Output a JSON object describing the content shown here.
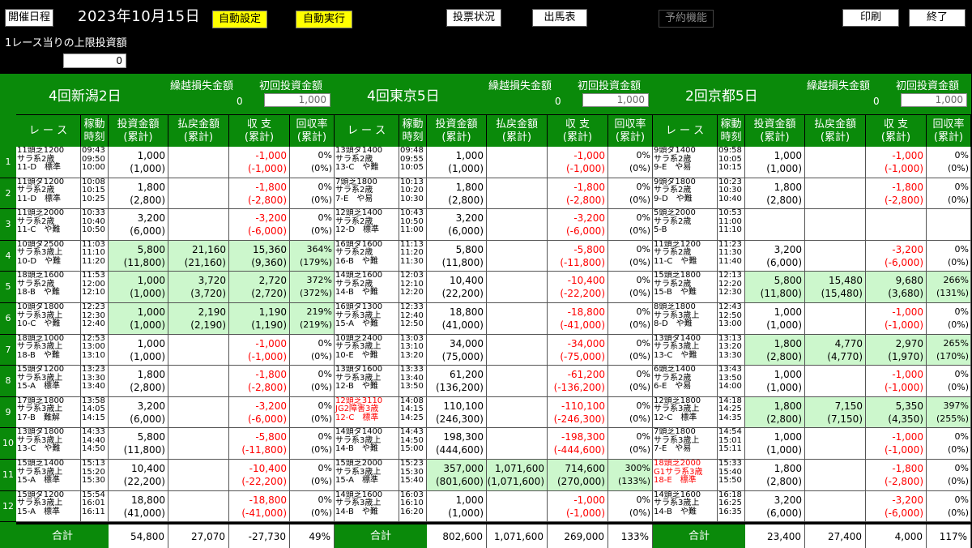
{
  "toolbar": {
    "schedule_label": "開催日程",
    "date": "2023年10月15日",
    "auto_setting_label": "自動設定",
    "auto_exec_label": "自動実行",
    "vote_status_label": "投票状況",
    "entries_label": "出馬表",
    "reservation_label": "予約機能",
    "print_label": "印刷",
    "exit_label": "終了"
  },
  "limit": {
    "label": "1レース当りの上限投資額",
    "value": "0"
  },
  "colheaders": {
    "race": "レ ー ス",
    "time": "稼動\n時刻",
    "invest": "投資金額\n(累計)",
    "refund": "払戻金額\n(累計)",
    "balance": "収 支\n(累計)",
    "rate": "回収率\n(累計)"
  },
  "venue_hdr": {
    "carry_label": "繰越損失金額",
    "initial_label": "初回投資金額"
  },
  "total_label": "合計",
  "venues": [
    {
      "name": "4回新潟2日",
      "carry": "0",
      "initial": "1,000",
      "rows": [
        {
          "race": [
            "11頭芝1200",
            "サラ系2歳",
            "11-D　標準"
          ],
          "times": [
            "09:43",
            "09:50",
            "10:00"
          ],
          "inv": "1,000",
          "invc": "(1,000)",
          "ref": "",
          "refc": "",
          "bal": "-1,000",
          "balc": "(-1,000)",
          "rate": "0%",
          "ratec": "(0%)",
          "green": false
        },
        {
          "race": [
            "11頭ダ1200",
            "サラ系2歳",
            "11-D　標準"
          ],
          "times": [
            "10:08",
            "10:15",
            "10:25"
          ],
          "inv": "1,800",
          "invc": "(2,800)",
          "ref": "",
          "refc": "",
          "bal": "-1,800",
          "balc": "(-2,800)",
          "rate": "0%",
          "ratec": "(0%)",
          "green": false
        },
        {
          "race": [
            "11頭芝2000",
            "サラ系2歳",
            "11-C　や難"
          ],
          "times": [
            "10:33",
            "10:40",
            "10:50"
          ],
          "inv": "3,200",
          "invc": "(6,000)",
          "ref": "",
          "refc": "",
          "bal": "-3,200",
          "balc": "(-6,000)",
          "rate": "0%",
          "ratec": "(0%)",
          "green": false
        },
        {
          "race": [
            "10頭ダ2500",
            "サラ系3歳上",
            "10-D　や難"
          ],
          "times": [
            "11:03",
            "11:10",
            "11:20"
          ],
          "inv": "5,800",
          "invc": "(11,800)",
          "ref": "21,160",
          "refc": "(21,160)",
          "bal": "15,360",
          "balc": "(9,360)",
          "rate": "364%",
          "ratec": "(179%)",
          "green": true
        },
        {
          "race": [
            "18頭芝1600",
            "サラ系2歳",
            "18-B　や難"
          ],
          "times": [
            "11:53",
            "12:00",
            "12:10"
          ],
          "inv": "1,000",
          "invc": "(1,000)",
          "ref": "3,720",
          "refc": "(3,720)",
          "bal": "2,720",
          "balc": "(2,720)",
          "rate": "372%",
          "ratec": "(372%)",
          "green": true
        },
        {
          "race": [
            "10頭ダ1800",
            "サラ系3歳上",
            "10-C　や難"
          ],
          "times": [
            "12:23",
            "12:30",
            "12:40"
          ],
          "inv": "1,000",
          "invc": "(1,000)",
          "ref": "2,190",
          "refc": "(2,190)",
          "bal": "1,190",
          "balc": "(1,190)",
          "rate": "219%",
          "ratec": "(219%)",
          "green": true
        },
        {
          "race": [
            "18頭芝1000",
            "サラ系3歳上",
            "18-B　や難"
          ],
          "times": [
            "12:53",
            "13:00",
            "13:10"
          ],
          "inv": "1,000",
          "invc": "(1,000)",
          "ref": "",
          "refc": "",
          "bal": "-1,000",
          "balc": "(-1,000)",
          "rate": "0%",
          "ratec": "(0%)",
          "green": false
        },
        {
          "race": [
            "15頭ダ1200",
            "サラ系3歳上",
            "15-A　標準"
          ],
          "times": [
            "13:23",
            "13:30",
            "13:40"
          ],
          "inv": "1,800",
          "invc": "(2,800)",
          "ref": "",
          "refc": "",
          "bal": "-1,800",
          "balc": "(-2,800)",
          "rate": "0%",
          "ratec": "(0%)",
          "green": false
        },
        {
          "race": [
            "17頭芝1800",
            "サラ系3歳上",
            "17-B　難解"
          ],
          "times": [
            "13:58",
            "14:05",
            "14:15"
          ],
          "inv": "3,200",
          "invc": "(6,000)",
          "ref": "",
          "refc": "",
          "bal": "-3,200",
          "balc": "(-6,000)",
          "rate": "0%",
          "ratec": "(0%)",
          "green": false
        },
        {
          "race": [
            "13頭ダ1800",
            "サラ系3歳上",
            "13-C　や難"
          ],
          "times": [
            "14:33",
            "14:40",
            "14:50"
          ],
          "inv": "5,800",
          "invc": "(11,800)",
          "ref": "",
          "refc": "",
          "bal": "-5,800",
          "balc": "(-11,800)",
          "rate": "0%",
          "ratec": "(0%)",
          "green": false
        },
        {
          "race": [
            "15頭芝1400",
            "サラ系3歳上",
            "15-A　標準"
          ],
          "times": [
            "15:13",
            "15:20",
            "15:30"
          ],
          "inv": "10,400",
          "invc": "(22,200)",
          "ref": "",
          "refc": "",
          "bal": "-10,400",
          "balc": "(-22,200)",
          "rate": "0%",
          "ratec": "(0%)",
          "green": false
        },
        {
          "race": [
            "15頭ダ1200",
            "サラ系3歳上",
            "15-A　標準"
          ],
          "times": [
            "15:54",
            "16:01",
            "16:11"
          ],
          "inv": "18,800",
          "invc": "(41,000)",
          "ref": "",
          "refc": "",
          "bal": "-18,800",
          "balc": "(-41,000)",
          "rate": "0%",
          "ratec": "(0%)",
          "green": false
        }
      ],
      "totals": {
        "inv": "54,800",
        "ref": "27,070",
        "bal": "-27,730",
        "rate": "49%"
      }
    },
    {
      "name": "4回東京5日",
      "carry": "0",
      "initial": "1,000",
      "rows": [
        {
          "race": [
            "13頭ダ1400",
            "サラ系2歳",
            "13-C　や難"
          ],
          "times": [
            "09:48",
            "09:55",
            "10:05"
          ],
          "inv": "1,000",
          "invc": "(1,000)",
          "ref": "",
          "refc": "",
          "bal": "-1,000",
          "balc": "(-1,000)",
          "rate": "0%",
          "ratec": "(0%)",
          "green": false
        },
        {
          "race": [
            "7頭芝1800",
            "サラ系2歳",
            "7-E　や易"
          ],
          "times": [
            "10:13",
            "10:20",
            "10:30"
          ],
          "inv": "1,800",
          "invc": "(2,800)",
          "ref": "",
          "refc": "",
          "bal": "-1,800",
          "balc": "(-2,800)",
          "rate": "0%",
          "ratec": "(0%)",
          "green": false
        },
        {
          "race": [
            "12頭芝1400",
            "サラ系2歳",
            "12-D　標準"
          ],
          "times": [
            "10:43",
            "10:50",
            "11:00"
          ],
          "inv": "3,200",
          "invc": "(6,000)",
          "ref": "",
          "refc": "",
          "bal": "-3,200",
          "balc": "(-6,000)",
          "rate": "0%",
          "ratec": "(0%)",
          "green": false
        },
        {
          "race": [
            "16頭ダ1600",
            "サラ系2歳",
            "16-B　や難"
          ],
          "times": [
            "11:13",
            "11:20",
            "11:30"
          ],
          "inv": "5,800",
          "invc": "(11,800)",
          "ref": "",
          "refc": "",
          "bal": "-5,800",
          "balc": "(-11,800)",
          "rate": "0%",
          "ratec": "(0%)",
          "green": false
        },
        {
          "race": [
            "14頭芝1600",
            "サラ系2歳",
            "14-B　や難"
          ],
          "times": [
            "12:03",
            "12:10",
            "12:20"
          ],
          "inv": "10,400",
          "invc": "(22,200)",
          "ref": "",
          "refc": "",
          "bal": "-10,400",
          "balc": "(-22,200)",
          "rate": "0%",
          "ratec": "(0%)",
          "green": false
        },
        {
          "race": [
            "16頭ダ1300",
            "サラ系3歳上",
            "15-A　や難"
          ],
          "times": [
            "12:33",
            "12:40",
            "12:50"
          ],
          "inv": "18,800",
          "invc": "(41,000)",
          "ref": "",
          "refc": "",
          "bal": "-18,800",
          "balc": "(-41,000)",
          "rate": "0%",
          "ratec": "(0%)",
          "green": false
        },
        {
          "race": [
            "10頭芝2400",
            "サラ系3歳上",
            "10-E　や難"
          ],
          "times": [
            "13:03",
            "13:10",
            "13:20"
          ],
          "inv": "34,000",
          "invc": "(75,000)",
          "ref": "",
          "refc": "",
          "bal": "-34,000",
          "balc": "(-75,000)",
          "rate": "0%",
          "ratec": "(0%)",
          "green": false
        },
        {
          "race": [
            "13頭ダ1600",
            "サラ系3歳上",
            "12-B　や難"
          ],
          "times": [
            "13:33",
            "13:40",
            "13:50"
          ],
          "inv": "61,200",
          "invc": "(136,200)",
          "ref": "",
          "refc": "",
          "bal": "-61,200",
          "balc": "(-136,200)",
          "rate": "0%",
          "ratec": "(0%)",
          "green": false
        },
        {
          "race": [
            "12頭芝3110",
            "JG2障害3歳",
            "12-C　標準"
          ],
          "times": [
            "14:08",
            "14:15",
            "14:25"
          ],
          "inv": "110,100",
          "invc": "(246,300)",
          "ref": "",
          "refc": "",
          "bal": "-110,100",
          "balc": "(-246,300)",
          "rate": "0%",
          "ratec": "(0%)",
          "green": false,
          "red": true
        },
        {
          "race": [
            "14頭ダ1400",
            "サラ系3歳上",
            "14-B　や難"
          ],
          "times": [
            "14:43",
            "14:50",
            "15:00"
          ],
          "inv": "198,300",
          "invc": "(444,600)",
          "ref": "",
          "refc": "",
          "bal": "-198,300",
          "balc": "(-444,600)",
          "rate": "0%",
          "ratec": "(0%)",
          "green": false
        },
        {
          "race": [
            "15頭芝2000",
            "サラ系3歳上",
            "15-A　標準"
          ],
          "times": [
            "15:23",
            "15:30",
            "15:40"
          ],
          "inv": "357,000",
          "invc": "(801,600)",
          "ref": "1,071,600",
          "refc": "(1,071,600)",
          "bal": "714,600",
          "balc": "(270,000)",
          "rate": "300%",
          "ratec": "(133%)",
          "green": true
        },
        {
          "race": [
            "14頭芝1600",
            "サラ系3歳上",
            "14-B　や難"
          ],
          "times": [
            "16:03",
            "16:10",
            "16:20"
          ],
          "inv": "1,000",
          "invc": "(1,000)",
          "ref": "",
          "refc": "",
          "bal": "-1,000",
          "balc": "(-1,000)",
          "rate": "0%",
          "ratec": "(0%)",
          "green": false
        }
      ],
      "totals": {
        "inv": "802,600",
        "ref": "1,071,600",
        "bal": "269,000",
        "rate": "133%"
      }
    },
    {
      "name": "2回京都5日",
      "carry": "0",
      "initial": "1,000",
      "rows": [
        {
          "race": [
            "9頭ダ1400",
            "サラ系2歳",
            "9-E　や易"
          ],
          "times": [
            "09:58",
            "10:05",
            "10:15"
          ],
          "inv": "1,000",
          "invc": "(1,000)",
          "ref": "",
          "refc": "",
          "bal": "-1,000",
          "balc": "(-1,000)",
          "rate": "0%",
          "ratec": "(0%)",
          "green": false
        },
        {
          "race": [
            "9頭ダ1800",
            "サラ系2歳",
            "9-D　や難"
          ],
          "times": [
            "10:23",
            "10:30",
            "10:40"
          ],
          "inv": "1,800",
          "invc": "(2,800)",
          "ref": "",
          "refc": "",
          "bal": "-1,800",
          "balc": "(-2,800)",
          "rate": "0%",
          "ratec": "(0%)",
          "green": false
        },
        {
          "race": [
            "5頭芝2000",
            "サラ系2歳",
            "5-B"
          ],
          "times": [
            "10:53",
            "11:00",
            "11:10"
          ],
          "inv": "",
          "invc": "",
          "ref": "",
          "refc": "",
          "bal": "",
          "balc": "",
          "rate": "",
          "ratec": "",
          "green": false
        },
        {
          "race": [
            "11頭芝1200",
            "サラ系2歳",
            "11-C　や難"
          ],
          "times": [
            "11:23",
            "11:30",
            "11:40"
          ],
          "inv": "3,200",
          "invc": "(6,000)",
          "ref": "",
          "refc": "",
          "bal": "-3,200",
          "balc": "(-6,000)",
          "rate": "0%",
          "ratec": "(0%)",
          "green": false
        },
        {
          "race": [
            "15頭芝1800",
            "サラ系2歳",
            "15-B　や難"
          ],
          "times": [
            "12:13",
            "12:20",
            "12:30"
          ],
          "inv": "5,800",
          "invc": "(11,800)",
          "ref": "15,480",
          "refc": "(15,480)",
          "bal": "9,680",
          "balc": "(3,680)",
          "rate": "266%",
          "ratec": "(131%)",
          "green": true
        },
        {
          "race": [
            "8頭芝1800",
            "サラ系3歳上",
            "8-D　や難"
          ],
          "times": [
            "12:43",
            "12:50",
            "13:00"
          ],
          "inv": "1,000",
          "invc": "(1,000)",
          "ref": "",
          "refc": "",
          "bal": "-1,000",
          "balc": "(-1,000)",
          "rate": "0%",
          "ratec": "(0%)",
          "green": false
        },
        {
          "race": [
            "13頭ダ1400",
            "サラ系3歳上",
            "13-C　や難"
          ],
          "times": [
            "13:13",
            "13:20",
            "13:30"
          ],
          "inv": "1,800",
          "invc": "(2,800)",
          "ref": "4,770",
          "refc": "(4,770)",
          "bal": "2,970",
          "balc": "(1,970)",
          "rate": "265%",
          "ratec": "(170%)",
          "green": true
        },
        {
          "race": [
            "6頭芝1400",
            "サラ系2歳",
            "6-E　や易"
          ],
          "times": [
            "13:43",
            "13:50",
            "14:00"
          ],
          "inv": "1,000",
          "invc": "(1,000)",
          "ref": "",
          "refc": "",
          "bal": "-1,000",
          "balc": "(-1,000)",
          "rate": "0%",
          "ratec": "(0%)",
          "green": false
        },
        {
          "race": [
            "12頭芝1800",
            "サラ系3歳上",
            "12-C　標準"
          ],
          "times": [
            "14:18",
            "14:25",
            "14:35"
          ],
          "inv": "1,800",
          "invc": "(2,800)",
          "ref": "7,150",
          "refc": "(7,150)",
          "bal": "5,350",
          "balc": "(4,350)",
          "rate": "397%",
          "ratec": "(255%)",
          "green": true
        },
        {
          "race": [
            "7頭芝1800",
            "サラ系3歳上",
            "7-E　や易"
          ],
          "times": [
            "14:54",
            "15:01",
            "15:11"
          ],
          "inv": "1,000",
          "invc": "(1,000)",
          "ref": "",
          "refc": "",
          "bal": "-1,000",
          "balc": "(-1,000)",
          "rate": "0%",
          "ratec": "(0%)",
          "green": false
        },
        {
          "race": [
            "18頭芝2000",
            "G1サラ系3歳",
            "18-E　標準"
          ],
          "times": [
            "15:33",
            "15:40",
            "15:50"
          ],
          "inv": "1,800",
          "invc": "(2,800)",
          "ref": "",
          "refc": "",
          "bal": "-1,800",
          "balc": "(-2,800)",
          "rate": "0%",
          "ratec": "(0%)",
          "green": false,
          "red": true
        },
        {
          "race": [
            "14頭芝1600",
            "サラ系3歳上",
            "14-B　や難"
          ],
          "times": [
            "16:18",
            "16:25",
            "16:35"
          ],
          "inv": "3,200",
          "invc": "(6,000)",
          "ref": "",
          "refc": "",
          "bal": "-3,200",
          "balc": "(-6,000)",
          "rate": "0%",
          "ratec": "(0%)",
          "green": false
        }
      ],
      "totals": {
        "inv": "23,400",
        "ref": "27,400",
        "bal": "4,000",
        "rate": "117%"
      }
    }
  ]
}
